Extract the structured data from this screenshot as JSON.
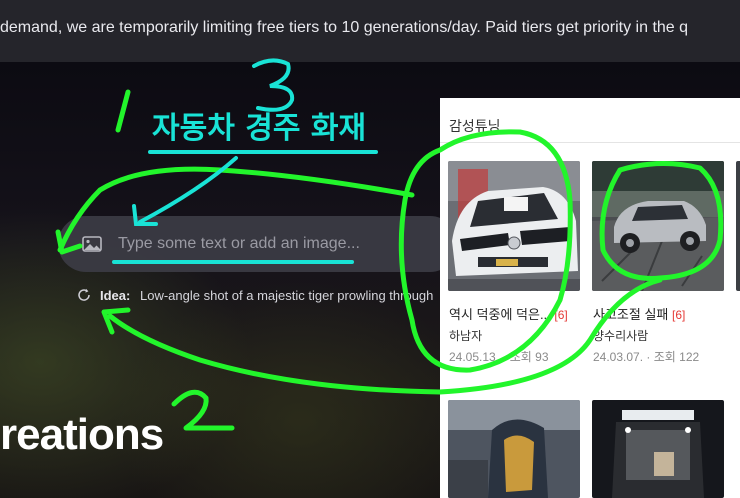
{
  "banner": {
    "text": "demand, we are temporarily limiting free tiers to 10 generations/day. Paid tiers get priority in the q"
  },
  "prompt": {
    "placeholder": "Type some text or add an image...",
    "image_icon": "image-icon"
  },
  "idea": {
    "icon": "refresh-icon",
    "label": "Idea:",
    "text": "Low-angle shot of a majestic tiger prowling through"
  },
  "hero": {
    "heading": "reations"
  },
  "panel": {
    "title": "감성튜닝",
    "cards": [
      {
        "title": "역시 덕중에 덕은...",
        "count": "[6]",
        "author": "하남자",
        "date": "24.05.13.",
        "views_label": "조회",
        "views": "93"
      },
      {
        "title": "사고조절 실패",
        "count": "[6]",
        "author": "양수리사람",
        "date": "24.03.07.",
        "views_label": "조회",
        "views": "122"
      }
    ]
  },
  "annotations": {
    "korean_note": "자동차 경주 화재",
    "numbers": [
      "1",
      "2",
      "3"
    ],
    "color": "#22f52b",
    "cyan": "#19e3d6"
  }
}
